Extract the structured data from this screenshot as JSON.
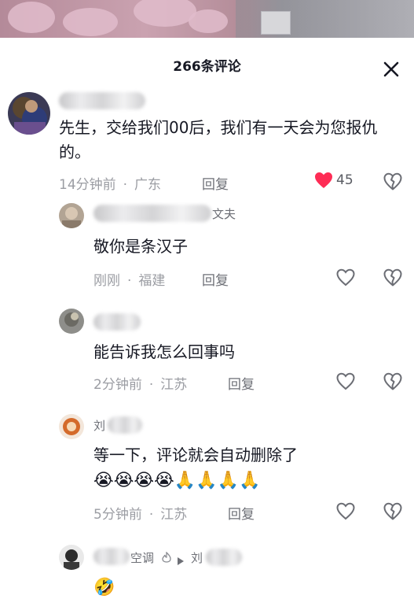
{
  "header": {
    "title": "266条评论"
  },
  "comments": [
    {
      "text": "先生，交给我们00后，我们有一天会为您报仇的。",
      "time": "14分钟前",
      "location": "广东",
      "reply_label": "回复",
      "likes": "45",
      "liked": true
    }
  ],
  "replies": [
    {
      "name_visible": "文夫",
      "text": "敬你是条汉子",
      "time": "刚刚",
      "location": "福建",
      "reply_label": "回复"
    },
    {
      "name_visible": "",
      "text": "能告诉我怎么回事吗",
      "time": "2分钟前",
      "location": "江苏",
      "reply_label": "回复"
    },
    {
      "name_visible": "刘",
      "text": "等一下，评论就会自动删除了",
      "emojis": "😭😭😭😭🙏🙏🙏🙏",
      "time": "5分钟前",
      "location": "江苏",
      "reply_label": "回复"
    },
    {
      "name_visible": "空调",
      "reply_to": "刘",
      "emojis": "🤣"
    }
  ],
  "colors": {
    "like_active": "#fe2c55",
    "meta": "#9b9da3",
    "text": "#161823"
  },
  "icons": [
    "close-icon",
    "heart-icon",
    "dislike-icon",
    "play-triangle-icon"
  ]
}
